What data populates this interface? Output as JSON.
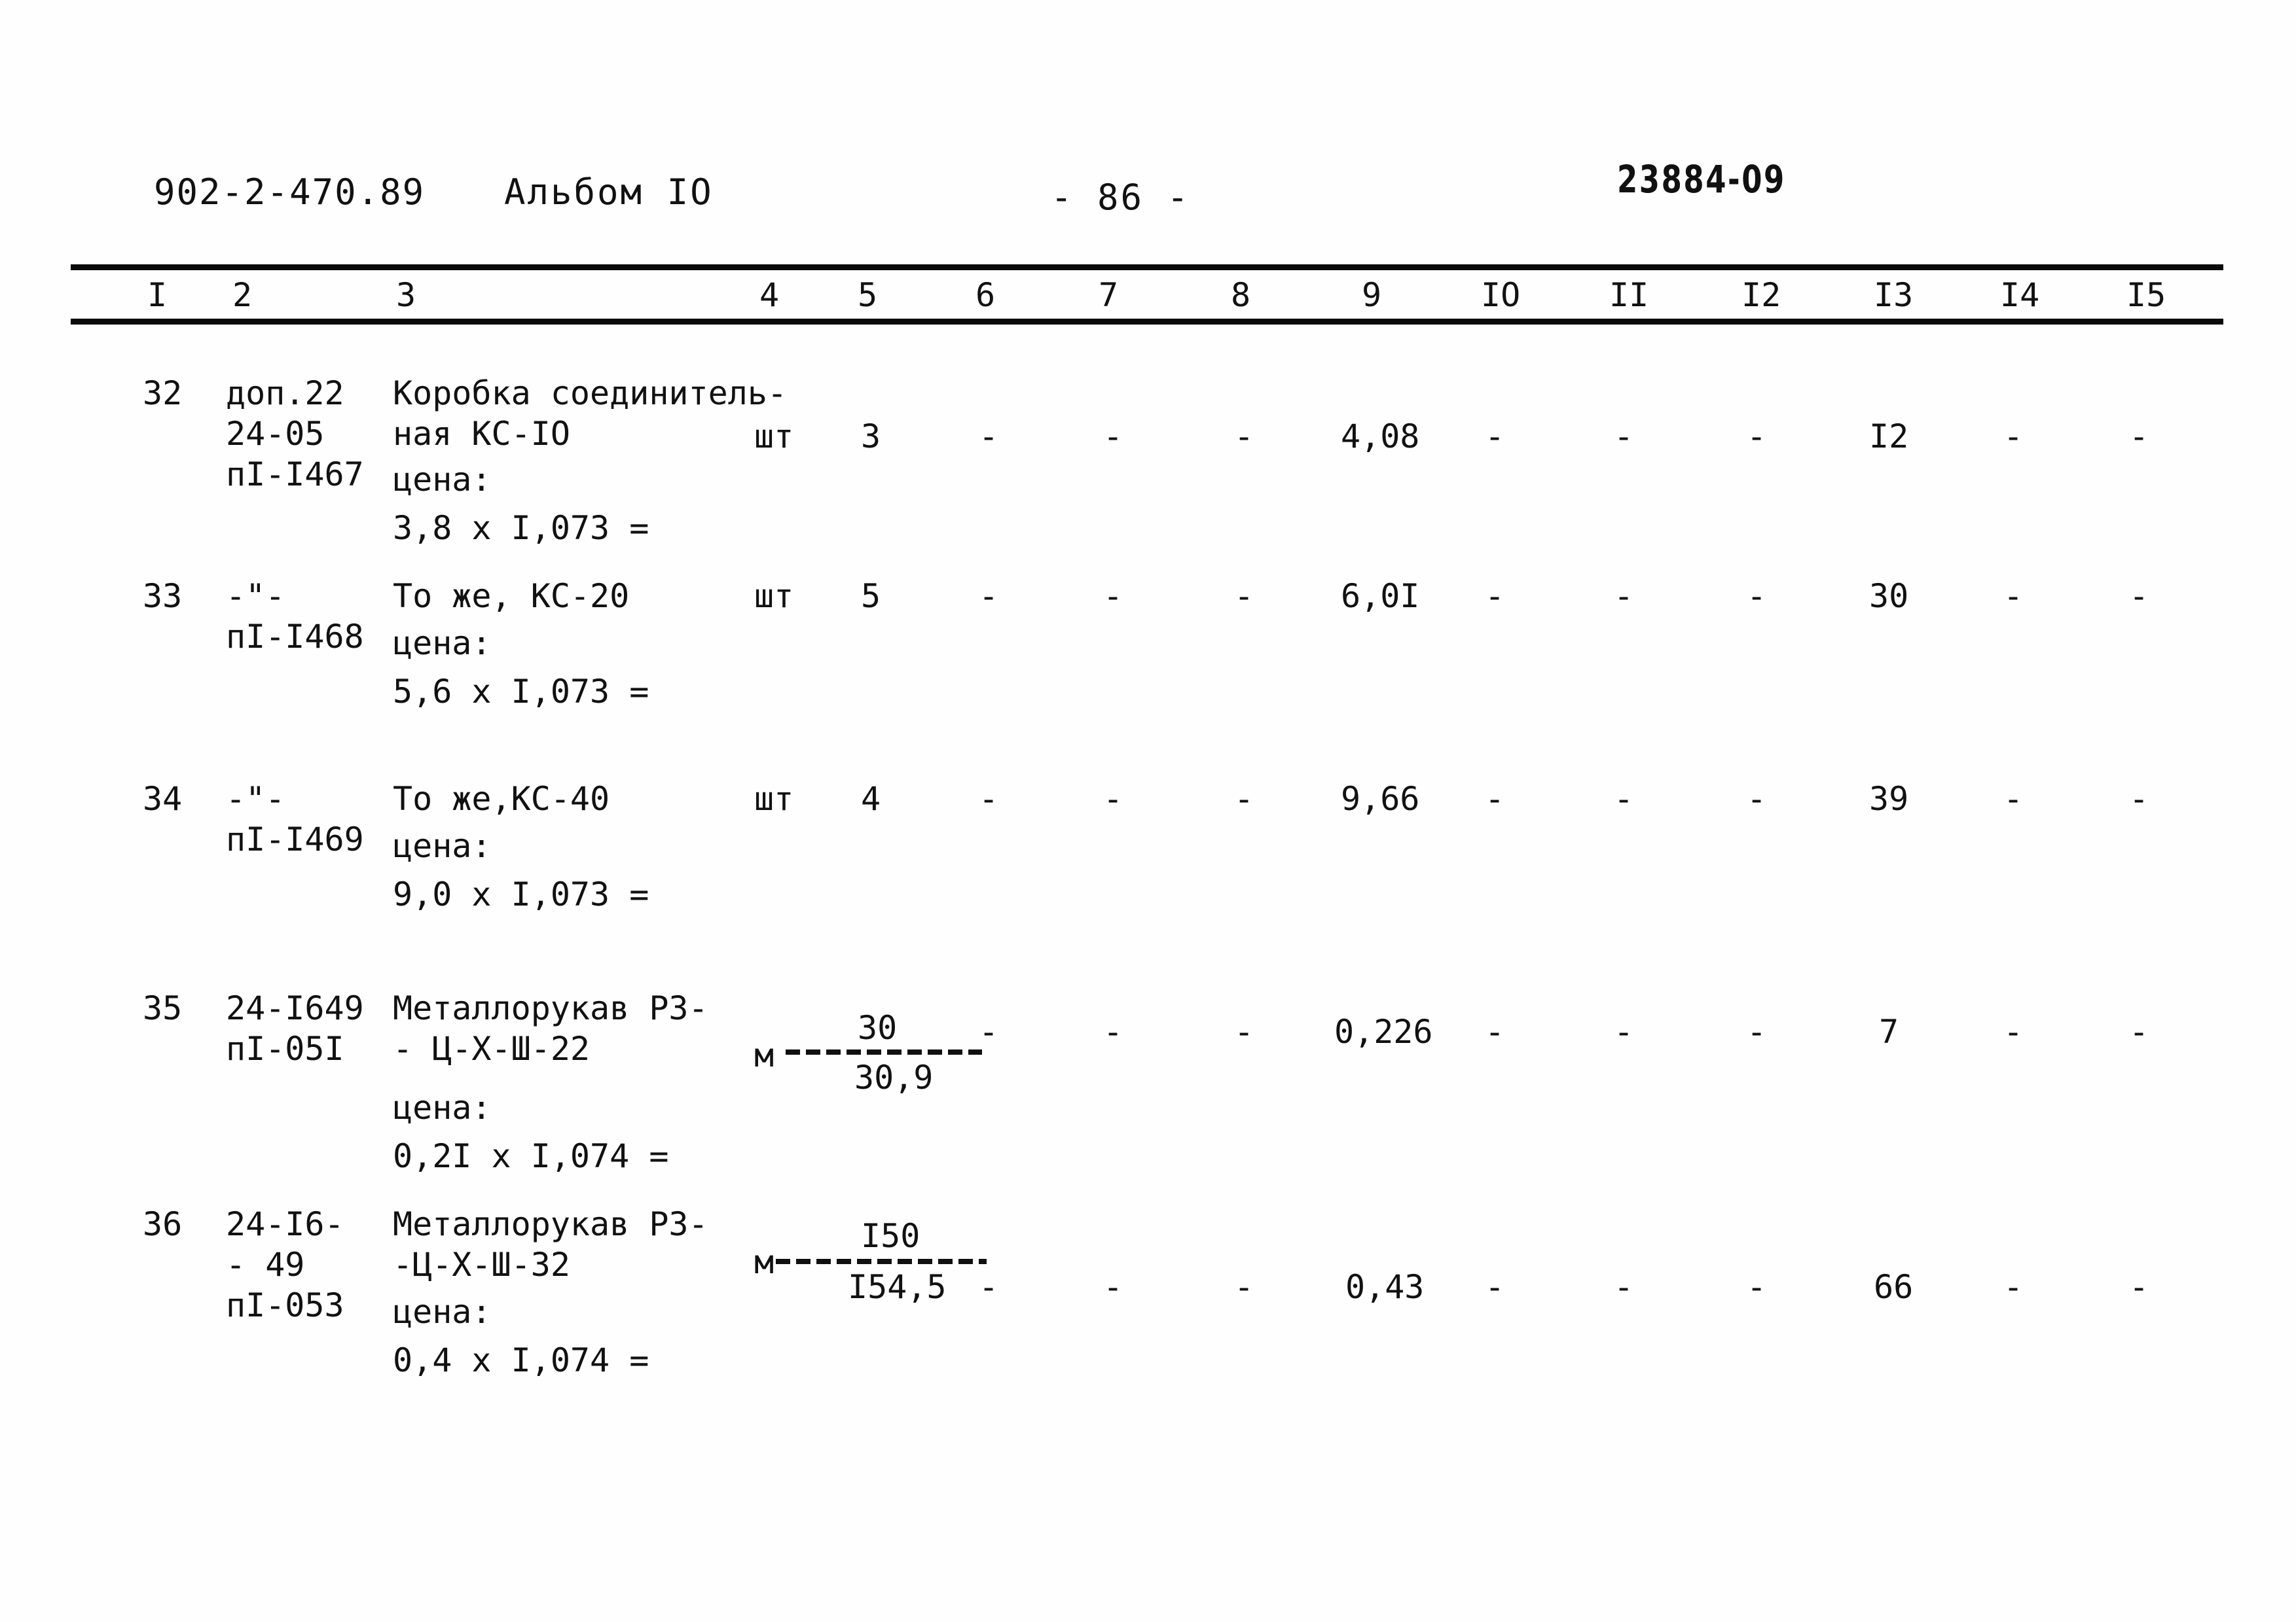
{
  "header": {
    "doc_code": "902-2-470.89",
    "album": "Альбом IO",
    "page_number": "- 86 -",
    "stamp": "23884-09"
  },
  "table": {
    "column_numbers": [
      "I",
      "2",
      "3",
      "4",
      "5",
      "6",
      "7",
      "8",
      "9",
      "IO",
      "II",
      "I2",
      "I3",
      "I4",
      "I5"
    ],
    "rows": [
      {
        "num": "32",
        "code_lines": [
          "доп.22",
          "24-05",
          "пI-I467"
        ],
        "name_lines": [
          "Коробка соединитель-",
          "ная КС-IO"
        ],
        "price_label": "цена:",
        "price_calc": "3,8 х I,073 =",
        "unit": "шт",
        "qty": "3",
        "c6": "-",
        "c7": "-",
        "c8": "-",
        "c9": "4,08",
        "c10": "-",
        "c11": "-",
        "c12": "-",
        "c13": "I2",
        "c14": "-",
        "c15": "-"
      },
      {
        "num": "33",
        "code_lines": [
          "-\"-",
          "пI-I468"
        ],
        "name_lines": [
          "То же, КС-20"
        ],
        "price_label": "цена:",
        "price_calc": "5,6 х I,073 =",
        "unit": "шт",
        "qty": "5",
        "c6": "-",
        "c7": "-",
        "c8": "-",
        "c9": "6,0I",
        "c10": "-",
        "c11": "-",
        "c12": "-",
        "c13": "30",
        "c14": "-",
        "c15": "-"
      },
      {
        "num": "34",
        "code_lines": [
          "-\"-",
          "пI-I469"
        ],
        "name_lines": [
          "То же,КС-40"
        ],
        "price_label": "цена:",
        "price_calc": "9,0 х I,073 =",
        "unit": "шт",
        "qty": "4",
        "c6": "-",
        "c7": "-",
        "c8": "-",
        "c9": "9,66",
        "c10": "-",
        "c11": "-",
        "c12": "-",
        "c13": "39",
        "c14": "-",
        "c15": "-"
      },
      {
        "num": "35",
        "code_lines": [
          "24-I649",
          "пI-05I"
        ],
        "name_lines": [
          "Металлорукав РЗ-",
          "- Ц-Х-Ш-22"
        ],
        "price_label": "цена:",
        "price_calc": "0,2I х I,074 =",
        "unit": "м",
        "qty_numerator": "30",
        "qty_denominator": "30,9",
        "c6": "-",
        "c7": "-",
        "c8": "-",
        "c9": "0,226",
        "c10": "-",
        "c11": "-",
        "c12": "-",
        "c13": "7",
        "c14": "-",
        "c15": "-"
      },
      {
        "num": "36",
        "code_lines": [
          "24-I6-",
          "- 49",
          "пI-053"
        ],
        "name_lines": [
          "Металлорукав РЗ-",
          "-Ц-Х-Ш-32"
        ],
        "price_label": "цена:",
        "price_calc": "0,4 х I,074 =",
        "unit": "м",
        "qty_numerator": "I50",
        "qty_denominator": "I54,5",
        "c6": "-",
        "c7": "-",
        "c8": "-",
        "c9": "0,43",
        "c10": "-",
        "c11": "-",
        "c12": "-",
        "c13": "66",
        "c14": "-",
        "c15": "-"
      }
    ]
  }
}
